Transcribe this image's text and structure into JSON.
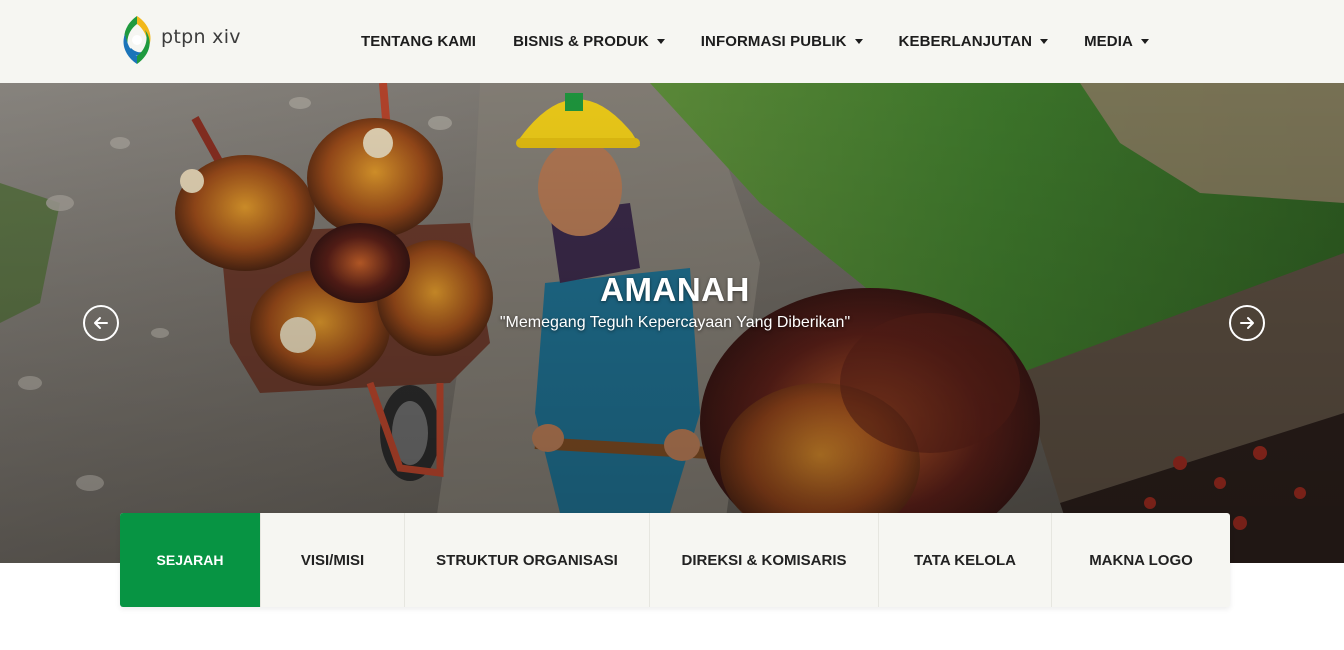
{
  "brand": {
    "name": "ptpn xiv",
    "logo_colors": {
      "green": "#1f9a3f",
      "yellow": "#f2b81b",
      "blue": "#1b74b9"
    }
  },
  "nav": {
    "items": [
      {
        "label": "TENTANG KAMI",
        "dropdown": false
      },
      {
        "label": "BISNIS & PRODUK",
        "dropdown": true
      },
      {
        "label": "INFORMASI PUBLIK",
        "dropdown": true
      },
      {
        "label": "KEBERLANJUTAN",
        "dropdown": true
      },
      {
        "label": "MEDIA",
        "dropdown": true
      }
    ]
  },
  "hero": {
    "title": "AMANAH",
    "subtitle": "\"Memegang Teguh Kepercayaan Yang Diberikan\"",
    "prev_icon": "arrow-left-icon",
    "next_icon": "arrow-right-icon"
  },
  "tabs": {
    "items": [
      {
        "label": "SEJARAH",
        "active": true
      },
      {
        "label": "VISI/MISI",
        "active": false
      },
      {
        "label": "STRUKTUR ORGANISASI",
        "active": false
      },
      {
        "label": "DIREKSI & KOMISARIS",
        "active": false
      },
      {
        "label": "TATA KELOLA",
        "active": false
      },
      {
        "label": "MAKNA LOGO",
        "active": false
      }
    ],
    "active_color": "#079443"
  }
}
